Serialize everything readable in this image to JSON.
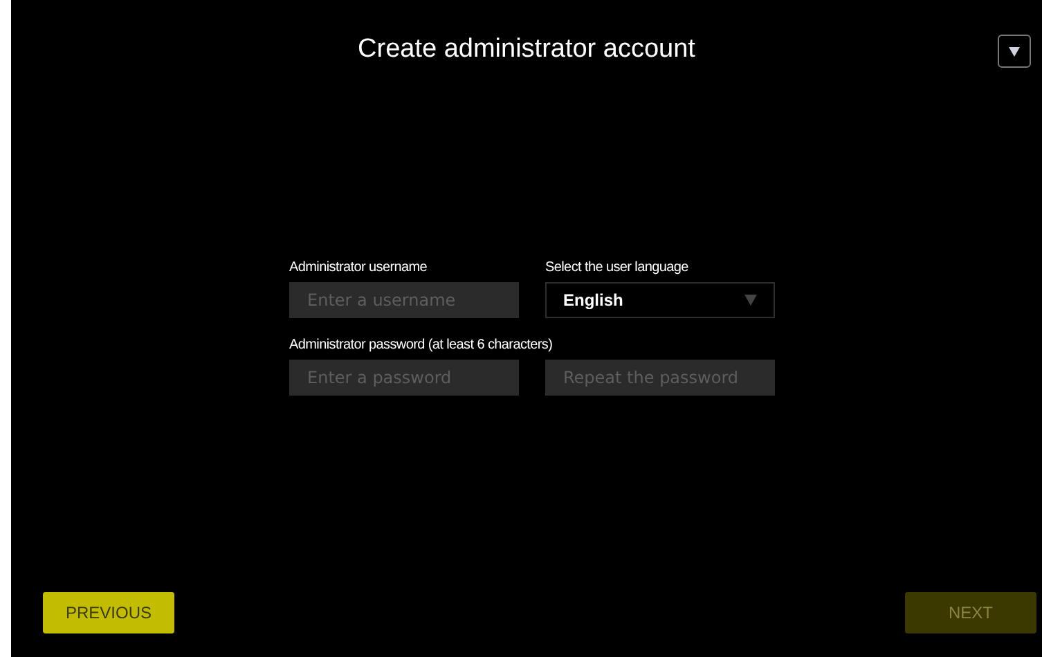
{
  "window": {
    "title": "Create administrator account"
  },
  "form": {
    "username_label": "Administrator username",
    "username": {
      "placeholder": "Enter a username"
    },
    "language_label": "Select the user language",
    "language": {
      "value": "English"
    },
    "password_label": "Administrator password (at least 6 characters)",
    "password": {
      "placeholder": "Enter a password"
    },
    "password_repeat": {
      "placeholder": "Repeat the password"
    }
  },
  "buttons": [
    {
      "label": "PREVIOUS",
      "disabled": false
    },
    {
      "label": "NEXT",
      "disabled": true
    }
  ]
}
